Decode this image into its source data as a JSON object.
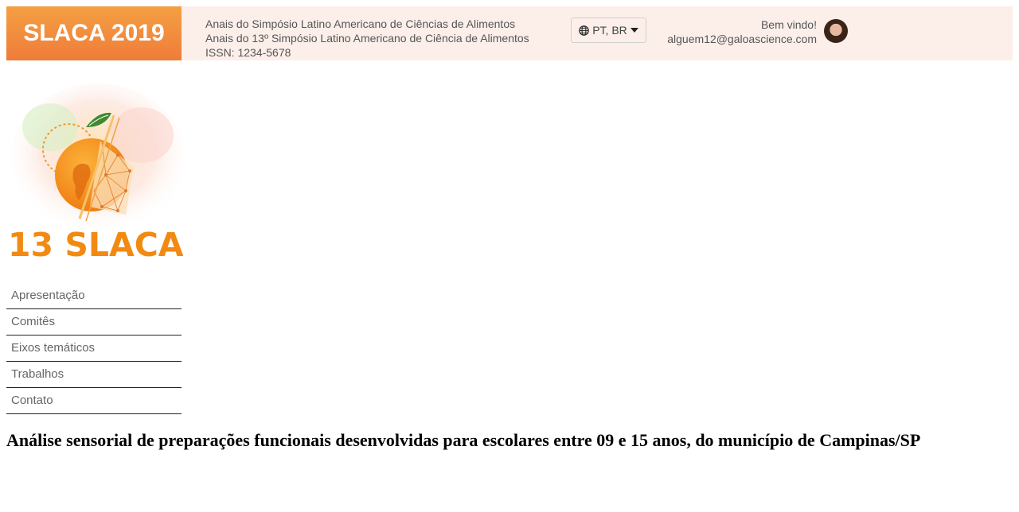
{
  "header": {
    "brand": "SLACA 2019",
    "journal_line1": "Anais do Simpósio Latino Americano de Ciências de Alimentos",
    "journal_line2": "Anais do 13º Simpósio Latino Americano de Ciência de Alimentos",
    "issn": "ISSN: 1234-5678",
    "language_label": "PT, BR",
    "welcome_text": "Bem vindo!",
    "user_email": "alguem12@galoascience.com"
  },
  "logo": {
    "text": "13 SLACA",
    "colors": {
      "orange": "#f28a12",
      "deep_orange": "#f26b10",
      "leaf": "#3d8b2f"
    }
  },
  "nav": {
    "items": [
      {
        "label": "Apresentação"
      },
      {
        "label": "Comitês"
      },
      {
        "label": "Eixos temáticos"
      },
      {
        "label": "Trabalhos"
      },
      {
        "label": "Contato"
      }
    ]
  },
  "main": {
    "title": "Análise sensorial de preparações funcionais desenvolvidas para escolares entre 09 e 15 anos, do município de Campinas/SP"
  },
  "colors": {
    "header_bg": "#fcefea",
    "brand_gradient_top": "#f4a043",
    "brand_gradient_bottom": "#ef7c3a"
  },
  "icons": [
    "globe-icon",
    "caret-down-icon"
  ]
}
